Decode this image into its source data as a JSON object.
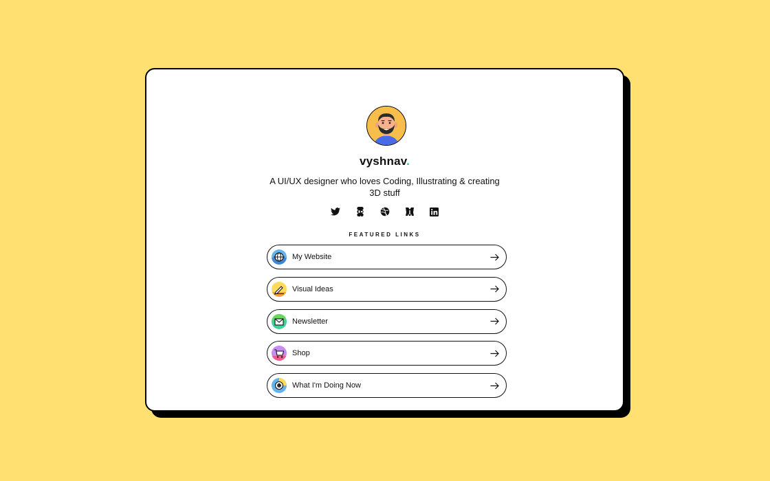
{
  "profile": {
    "name": "vyshnav",
    "name_dot": ".",
    "bio": "A UI/UX designer who loves Coding, Illustrating & creating 3D stuff"
  },
  "socials": [
    {
      "name": "twitter-icon",
      "label": "Twitter"
    },
    {
      "name": "figma-icon",
      "label": "Figma"
    },
    {
      "name": "dribbble-icon",
      "label": "Dribbble"
    },
    {
      "name": "behance-icon",
      "label": "Behance"
    },
    {
      "name": "linkedin-icon",
      "label": "LinkedIn"
    }
  ],
  "featured": {
    "heading": "FEATURED LINKS",
    "links": [
      {
        "label": "My Website",
        "icon": "globe-icon",
        "color": "#63B3F0"
      },
      {
        "label": "Visual Ideas",
        "icon": "pencil-icon",
        "color": "#FFDB58"
      },
      {
        "label": "Newsletter",
        "icon": "envelope-icon",
        "color": "#3FD39A"
      },
      {
        "label": "Shop",
        "icon": "cart-icon",
        "color": "#C98BF2"
      },
      {
        "label": "What I'm Doing Now",
        "icon": "clock-icon",
        "color": "#63B3F0"
      }
    ]
  },
  "colors": {
    "background": "#FFE070",
    "card": "#FFFFFF",
    "accent": "#1FC0A5"
  }
}
